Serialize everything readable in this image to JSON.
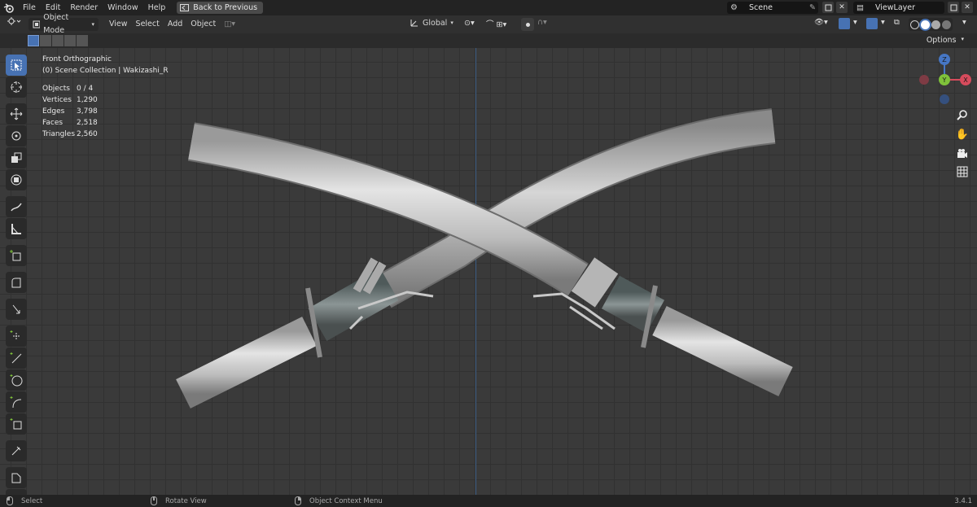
{
  "topbar": {
    "menus": [
      "File",
      "Edit",
      "Render",
      "Window",
      "Help"
    ],
    "back_button": "Back to Previous",
    "scene_name": "Scene",
    "viewlayer_name": "ViewLayer"
  },
  "header": {
    "mode": "Object Mode",
    "menus": [
      "View",
      "Select",
      "Add",
      "Object"
    ],
    "orientation": "Global",
    "options_label": "Options"
  },
  "viewport": {
    "view_name": "Front Orthographic",
    "collection_path": "(0) Scene Collection | Wakizashi_R",
    "stats": [
      {
        "label": "Objects",
        "value": "0 / 4"
      },
      {
        "label": "Vertices",
        "value": "1,290"
      },
      {
        "label": "Edges",
        "value": "3,798"
      },
      {
        "label": "Faces",
        "value": "2,518"
      },
      {
        "label": "Triangles",
        "value": "2,560"
      }
    ],
    "gizmo": {
      "z": "Z",
      "y": "Y",
      "x": "X"
    }
  },
  "statusbar": {
    "select": "Select",
    "rotate": "Rotate View",
    "context": "Object Context Menu",
    "version": "3.4.1"
  },
  "colors": {
    "accent": "#4772b3",
    "x_axis": "#d64b5c",
    "y_axis": "#7fc23a",
    "z_axis": "#4676c4"
  }
}
